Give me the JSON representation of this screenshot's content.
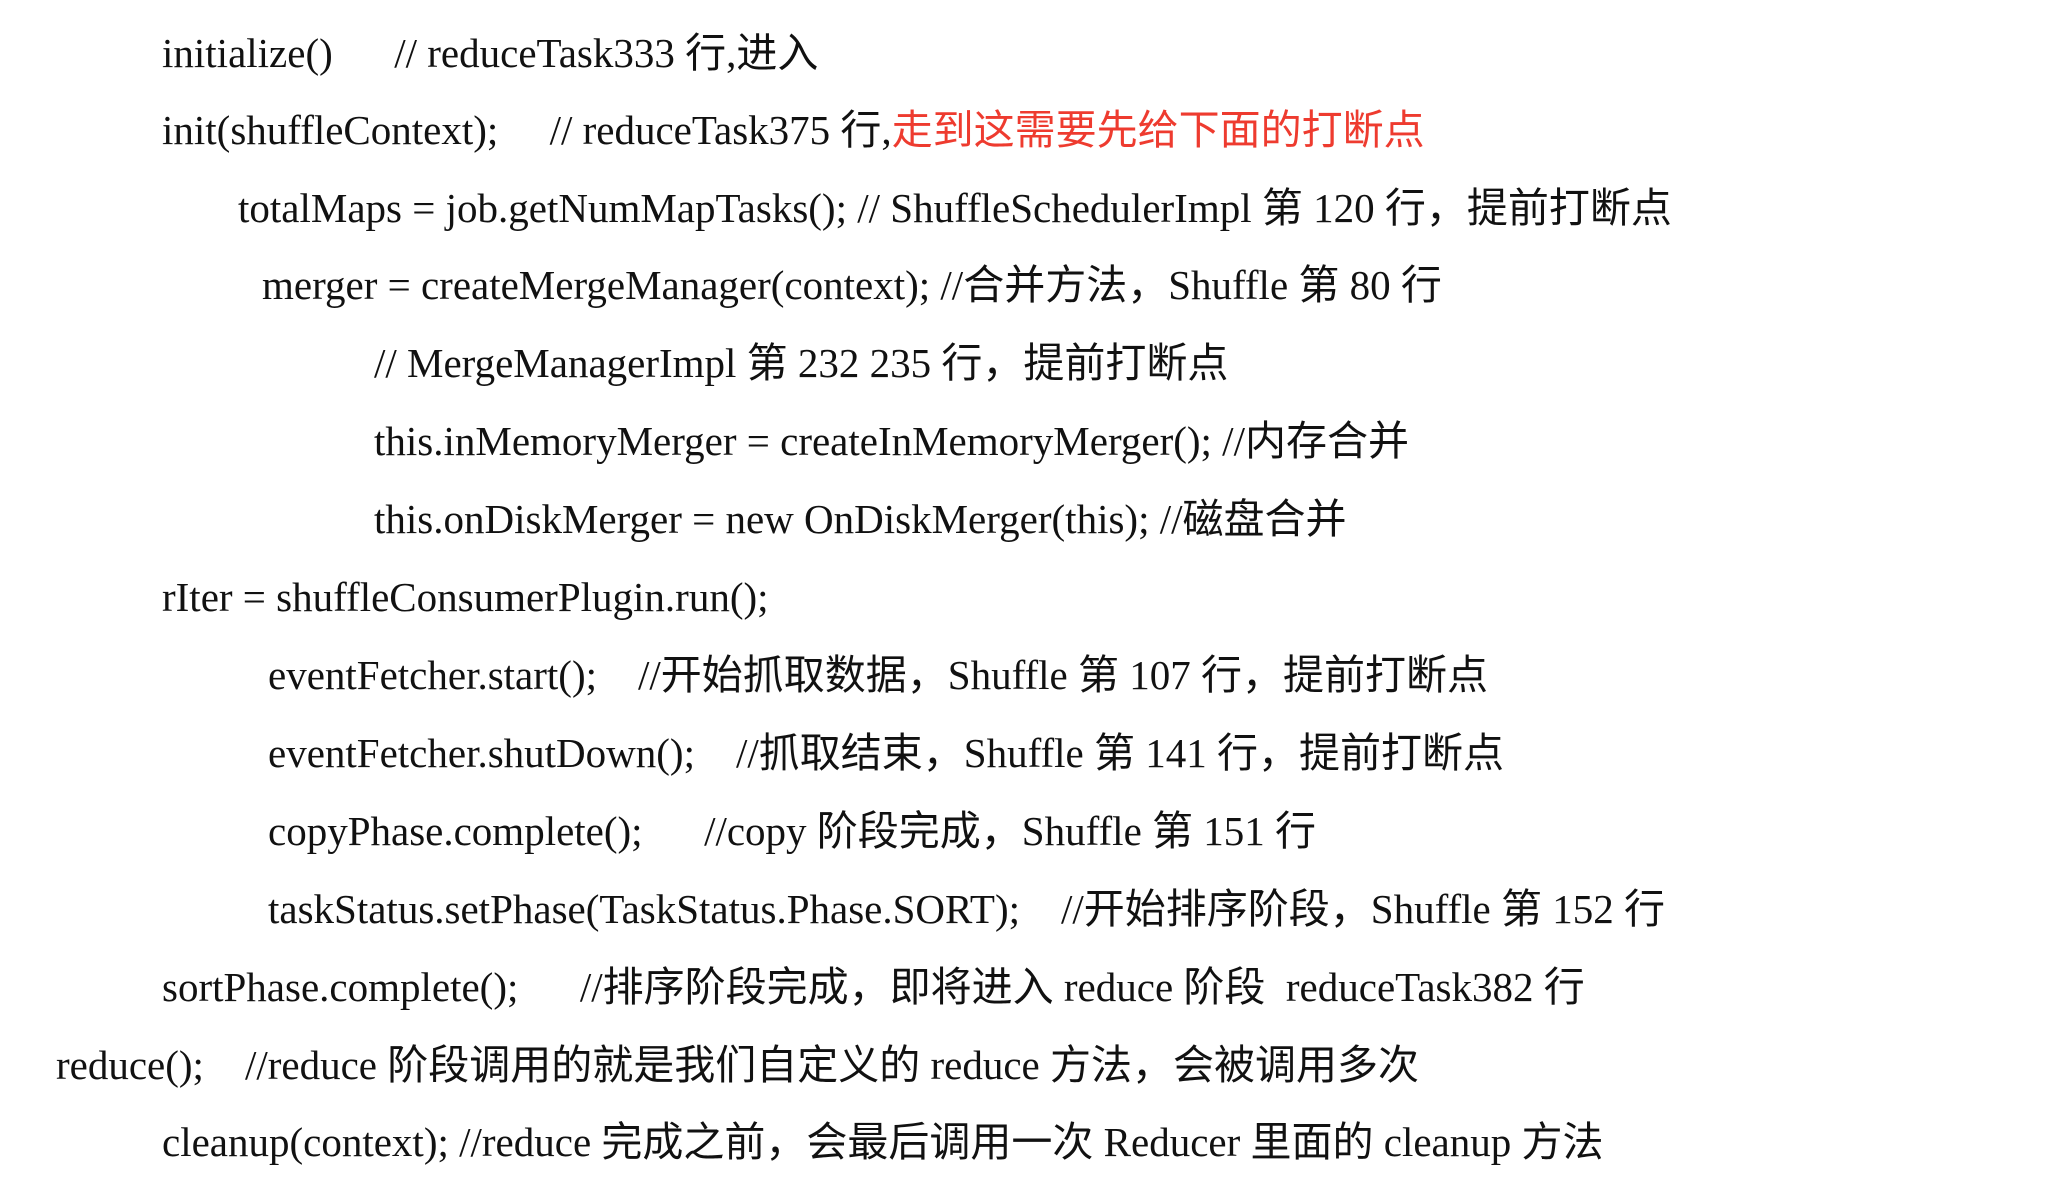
{
  "lines": [
    {
      "code": "initialize()",
      "gap": "      ",
      "comment": "// reduceTask333 行,进入",
      "highlight": ""
    },
    {
      "code": "init(shuffleContext);",
      "gap": "     ",
      "comment": "// reduceTask375 行,",
      "highlight": "走到这需要先给下面的打断点"
    },
    {
      "code": "totalMaps = job.getNumMapTasks();",
      "gap": " ",
      "comment": "// ShuffleSchedulerImpl 第 120 行，提前打断点",
      "highlight": ""
    },
    {
      "code": "merger = createMergeManager(context);",
      "gap": " ",
      "comment": "//合并方法，Shuffle 第 80 行",
      "highlight": ""
    },
    {
      "code": "",
      "gap": "",
      "comment": "// MergeManagerImpl 第 232 235 行，提前打断点",
      "highlight": ""
    },
    {
      "code": "this.inMemoryMerger = createInMemoryMerger();",
      "gap": " ",
      "comment": "//内存合并",
      "highlight": ""
    },
    {
      "code": "this.onDiskMerger = new OnDiskMerger(this);",
      "gap": " ",
      "comment": "//磁盘合并",
      "highlight": ""
    },
    {
      "code": "rIter = shuffleConsumerPlugin.run();",
      "gap": "",
      "comment": "",
      "highlight": ""
    },
    {
      "code": "eventFetcher.start();",
      "gap": "    ",
      "comment": "//开始抓取数据，Shuffle 第 107 行，提前打断点",
      "highlight": ""
    },
    {
      "code": "eventFetcher.shutDown();",
      "gap": "    ",
      "comment": "//抓取结束，Shuffle 第 141 行，提前打断点",
      "highlight": ""
    },
    {
      "code": "copyPhase.complete();",
      "gap": "      ",
      "comment": "//copy 阶段完成，Shuffle 第 151 行",
      "highlight": ""
    },
    {
      "code": "taskStatus.setPhase(TaskStatus.Phase.SORT);",
      "gap": "    ",
      "comment": "//开始排序阶段，Shuffle 第 152 行",
      "highlight": ""
    },
    {
      "code": "sortPhase.complete();",
      "gap": "      ",
      "comment": "//排序阶段完成，即将进入 reduce 阶段  reduceTask382 行",
      "highlight": ""
    },
    {
      "code": "reduce();",
      "gap": "    ",
      "comment": "//reduce 阶段调用的就是我们自定义的 reduce 方法，会被调用多次",
      "highlight": ""
    },
    {
      "code": "cleanup(context);",
      "gap": " ",
      "comment": "//reduce 完成之前，会最后调用一次 Reducer 里面的 cleanup 方法",
      "highlight": ""
    }
  ]
}
